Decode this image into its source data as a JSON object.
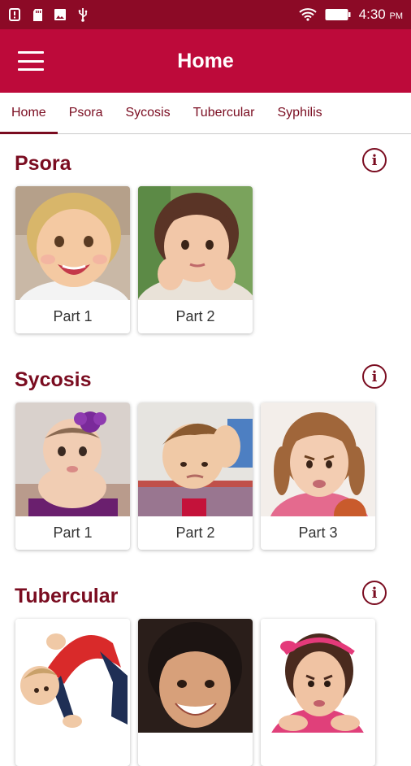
{
  "status": {
    "time": "4:30",
    "ampm": "PM"
  },
  "app_bar": {
    "title": "Home"
  },
  "tabs": [
    {
      "label": "Home"
    },
    {
      "label": "Psora"
    },
    {
      "label": "Sycosis"
    },
    {
      "label": "Tubercular"
    },
    {
      "label": "Syphilis"
    }
  ],
  "sections": [
    {
      "title": "Psora",
      "cards": [
        {
          "label": "Part 1",
          "image": "smiling-toddler-blonde"
        },
        {
          "label": "Part 2",
          "image": "toddler-hands-on-cheeks"
        }
      ]
    },
    {
      "title": "Sycosis",
      "cards": [
        {
          "label": "Part 1",
          "image": "baby-with-purple-bow"
        },
        {
          "label": "Part 2",
          "image": "boy-holding-head"
        },
        {
          "label": "Part 3",
          "image": "pouting-girl-pigtails"
        }
      ]
    },
    {
      "title": "Tubercular",
      "cards": [
        {
          "label": "",
          "image": "child-in-backbend"
        },
        {
          "label": "",
          "image": "smiling-boy-dark-hair"
        },
        {
          "label": "",
          "image": "girl-with-pink-headband"
        }
      ]
    }
  ],
  "colors": {
    "status_bar": "#8c0a26",
    "app_bar": "#bd0a3a",
    "accent": "#7a0c20"
  }
}
